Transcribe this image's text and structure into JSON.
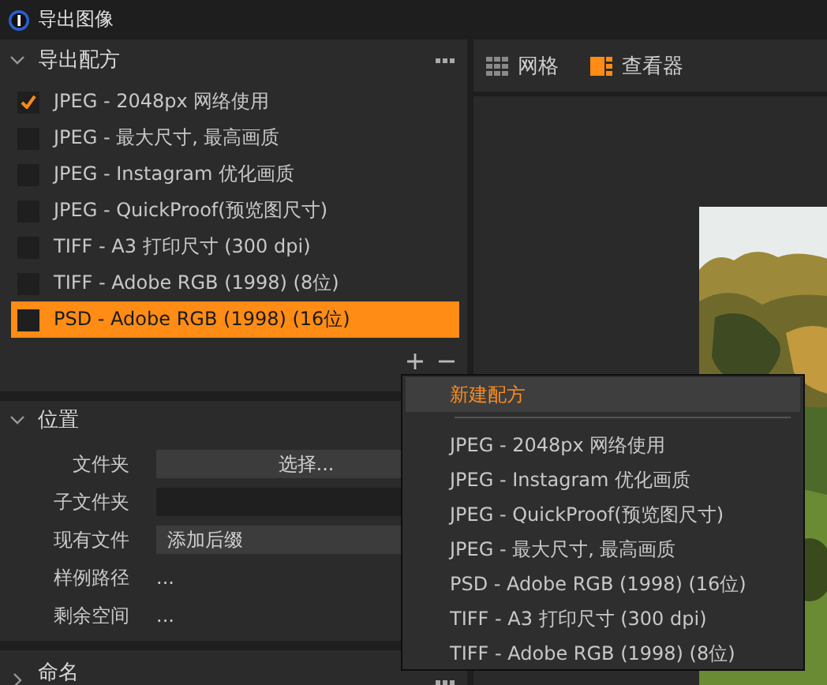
{
  "window": {
    "title": "导出图像"
  },
  "recipes": {
    "title": "导出配方",
    "expanded": true,
    "items": [
      {
        "label": "JPEG - 2048px 网络使用",
        "checked": true,
        "selected": false
      },
      {
        "label": "JPEG - 最大尺寸, 最高画质",
        "checked": false,
        "selected": false
      },
      {
        "label": "JPEG - Instagram 优化画质",
        "checked": false,
        "selected": false
      },
      {
        "label": "JPEG - QuickProof(预览图尺寸)",
        "checked": false,
        "selected": false
      },
      {
        "label": "TIFF - A3 打印尺寸 (300 dpi)",
        "checked": false,
        "selected": false
      },
      {
        "label": "TIFF - Adobe RGB (1998) (8位)",
        "checked": false,
        "selected": false
      },
      {
        "label": "PSD - Adobe RGB (1998) (16位)",
        "checked": false,
        "selected": true
      }
    ]
  },
  "location": {
    "title": "位置",
    "expanded": true,
    "fields": [
      {
        "label": "文件夹",
        "kind": "button",
        "value": "选择..."
      },
      {
        "label": "子文件夹",
        "kind": "input"
      },
      {
        "label": "现有文件",
        "kind": "select",
        "value": "添加后缀"
      },
      {
        "label": "样例路径",
        "kind": "text",
        "value": "..."
      },
      {
        "label": "剩余空间",
        "kind": "text",
        "value": "..."
      }
    ]
  },
  "naming": {
    "title": "命名"
  },
  "view_tabs": [
    {
      "label": "网格",
      "kind": "grid",
      "selected": false
    },
    {
      "label": "查看器",
      "kind": "viewer",
      "selected": true
    }
  ],
  "context_menu": [
    {
      "label": "新建配方",
      "kind": "action",
      "highlighted": true
    },
    {
      "label": "JPEG - 2048px 网络使用",
      "kind": "recipe",
      "highlighted": false
    },
    {
      "label": "JPEG - Instagram 优化画质",
      "kind": "recipe",
      "highlighted": false
    },
    {
      "label": "JPEG - QuickProof(预览图尺寸)",
      "kind": "recipe",
      "highlighted": false
    },
    {
      "label": "JPEG - 最大尺寸, 最高画质",
      "kind": "recipe",
      "highlighted": false
    },
    {
      "label": "PSD - Adobe RGB (1998) (16位)",
      "kind": "recipe",
      "highlighted": false
    },
    {
      "label": "TIFF - A3 打印尺寸 (300 dpi)",
      "kind": "recipe",
      "highlighted": false
    },
    {
      "label": "TIFF - Adobe RGB (1998) (8位)",
      "kind": "recipe",
      "highlighted": false
    }
  ]
}
